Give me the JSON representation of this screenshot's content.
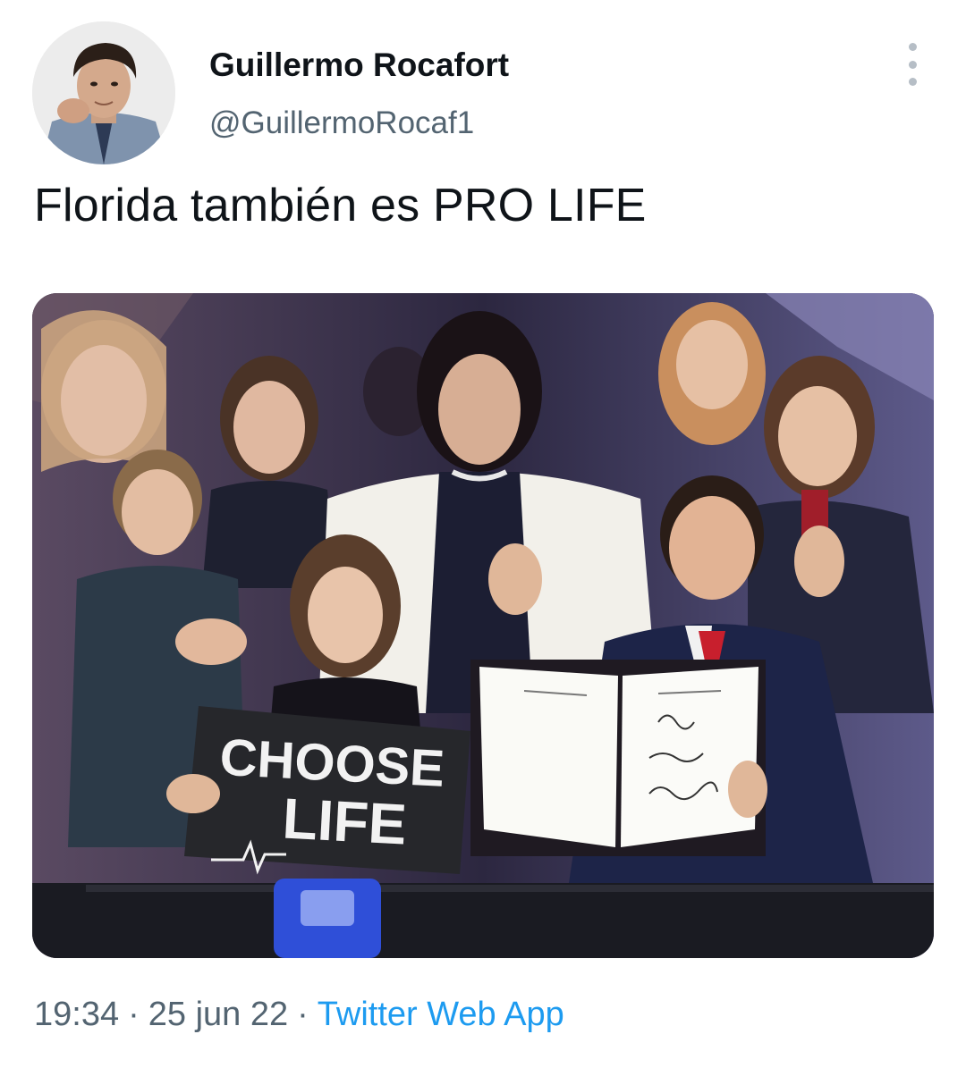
{
  "tweet": {
    "author": {
      "display_name": "Guillermo Rocafort",
      "handle": "@GuillermoRocaf1"
    },
    "text": "Florida también es PRO LIFE",
    "media": {
      "sign_line1": "CHOOSE",
      "sign_line2": "LIFE"
    },
    "meta": {
      "time": "19:34",
      "separator": "·",
      "date": "25 jun 22",
      "source": "Twitter Web App"
    },
    "icons": {
      "more": "more-vertical-icon"
    },
    "colors": {
      "text": "#0f1419",
      "secondary": "#536471",
      "link": "#1d9bf0"
    }
  }
}
